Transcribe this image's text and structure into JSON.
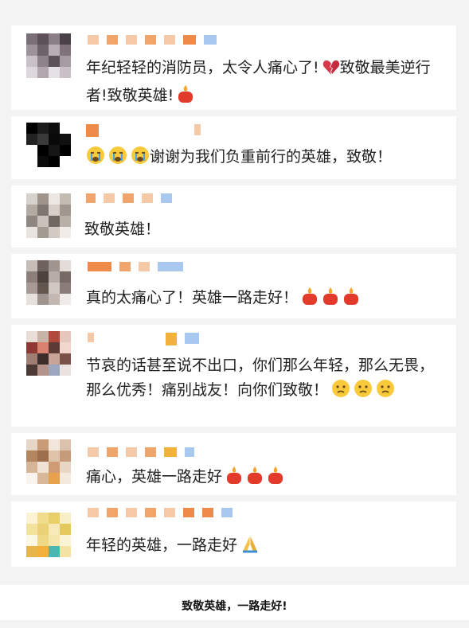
{
  "comments": [
    {
      "text": "年纪轻轻的消防员，太令人痛心了!",
      "text2": "致敬最美逆行者!致敬英雄!",
      "emoji_after_1": "broken-heart-icon",
      "emoji_after_2": "candle-icon"
    },
    {
      "text": "谢谢为我们负重前行的英雄，致敬！",
      "emoji_before": "crying-face-icon x3"
    },
    {
      "text": "致敬英雄！"
    },
    {
      "text": "真的太痛心了！英雄一路走好！",
      "emoji_after": "candle-icon x3"
    },
    {
      "text": "节哀的话甚至说不出口，你们那么年轻，那么无畏，那么优秀！痛别战友！向你们致敬！",
      "emoji_after": "sad-face-icon x3"
    },
    {
      "text": "痛心，英雄一路走好",
      "emoji_after": "candle-icon x3"
    },
    {
      "text": "年轻的英雄，一路走好",
      "emoji_after": "praying-hands-icon"
    }
  ],
  "footer": {
    "caption": "致敬英雄，一路走好!"
  },
  "colors": {
    "blur_orange": "#f2a56a",
    "blur_blue": "#a9c8f0",
    "candle_red": "#e23b2b"
  }
}
